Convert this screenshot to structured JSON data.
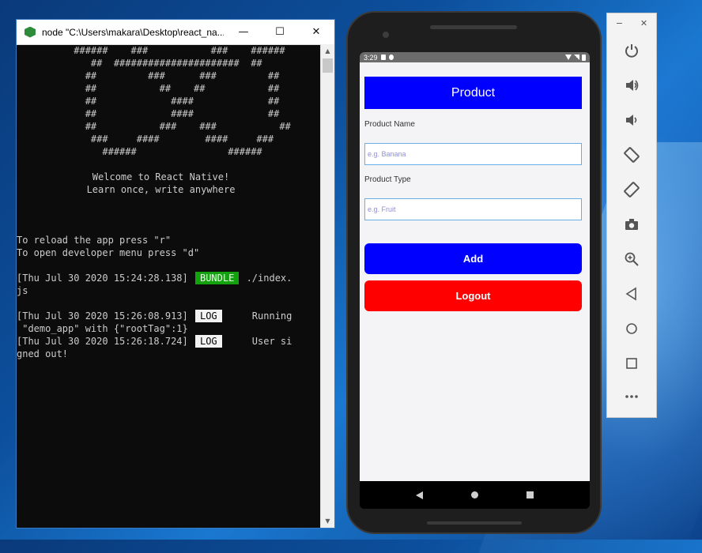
{
  "console": {
    "title": "node  \"C:\\Users\\makara\\Desktop\\react_na...",
    "controls": {
      "minimize": "—",
      "maximize": "☐",
      "close": "✕"
    },
    "logo_lines": [
      "          ######    ###           ###    ######",
      "",
      "             ##  ######################  ##",
      "            ##         ###      ###         ##",
      "            ##           ##    ##           ##",
      "            ##             ####             ##",
      "            ##             ####             ##",
      "            ##           ###    ###           ##",
      "             ###     ####        ####     ###",
      "               ######                ######"
    ],
    "welcome": "Welcome to React Native!",
    "tagline": "Learn once, write anywhere",
    "reload_hint": "To reload the app press \"r\"",
    "devmenu_hint": "To open developer menu press \"d\"",
    "log1_time": "[Thu Jul 30 2020 15:24:28.138]",
    "log1_tag": "BUNDLE",
    "log1_msg_a": " ./index.",
    "log1_msg_b": "js",
    "log2_time": "[Thu Jul 30 2020 15:26:08.913]",
    "log2_tag": "LOG",
    "log2_msg_a": "     Running",
    "log2_msg_b": " \"demo_app\" with {\"rootTag\":1}",
    "log3_time": "[Thu Jul 30 2020 15:26:18.724]",
    "log3_tag": "LOG",
    "log3_msg_a": "     User si",
    "log3_msg_b": "gned out!"
  },
  "phone": {
    "status_time": "3:29",
    "header_title": "Product",
    "product_name_label": "Product Name",
    "product_name_placeholder": "e.g. Banana",
    "product_type_label": "Product Type",
    "product_type_placeholder": "e.g. Fruit",
    "add_label": "Add",
    "logout_label": "Logout"
  },
  "toolbar": {
    "min": "−",
    "close": "✕",
    "items": [
      "power-icon",
      "volume-up-icon",
      "volume-down-icon",
      "rotate-left-icon",
      "rotate-right-icon",
      "camera-icon",
      "zoom-icon",
      "back-icon",
      "home-icon",
      "overview-icon",
      "more-icon"
    ]
  },
  "colors": {
    "header_blue": "#0000ff",
    "logout_red": "#ff0000",
    "bundle_green": "#13a10e",
    "react_blue": "#3b82f6"
  }
}
